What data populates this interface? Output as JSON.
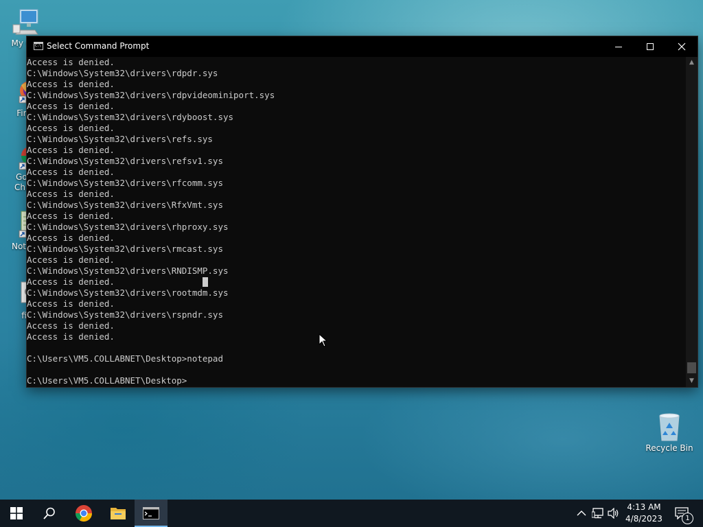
{
  "desktop": {
    "icons": [
      {
        "label": "My Co",
        "icon": "computer-icon"
      },
      {
        "label": "Fire",
        "icon": "firefox-icon"
      },
      {
        "label": "Goo",
        "label2": "Chro",
        "icon": "chrome-icon"
      },
      {
        "label": "Notep",
        "icon": "notepad-icon"
      },
      {
        "label": "fi",
        "icon": "file-icon"
      },
      {
        "label": "Recycle Bin",
        "icon": "recycle-bin-icon"
      }
    ]
  },
  "window": {
    "title": "Select Command Prompt",
    "controls": {
      "minimize": "minimize",
      "maximize": "maximize",
      "close": "close"
    }
  },
  "console": {
    "lines": [
      "Access is denied.",
      "C:\\Windows\\System32\\drivers\\rdpdr.sys",
      "Access is denied.",
      "C:\\Windows\\System32\\drivers\\rdpvideominiport.sys",
      "Access is denied.",
      "C:\\Windows\\System32\\drivers\\rdyboost.sys",
      "Access is denied.",
      "C:\\Windows\\System32\\drivers\\refs.sys",
      "Access is denied.",
      "C:\\Windows\\System32\\drivers\\refsv1.sys",
      "Access is denied.",
      "C:\\Windows\\System32\\drivers\\rfcomm.sys",
      "Access is denied.",
      "C:\\Windows\\System32\\drivers\\RfxVmt.sys",
      "Access is denied.",
      "C:\\Windows\\System32\\drivers\\rhproxy.sys",
      "Access is denied.",
      "C:\\Windows\\System32\\drivers\\rmcast.sys",
      "Access is denied.",
      "C:\\Windows\\System32\\drivers\\RNDISMP.sys",
      "Access is denied.",
      "C:\\Windows\\System32\\drivers\\rootmdm.sys",
      "Access is denied.",
      "C:\\Windows\\System32\\drivers\\rspndr.sys",
      "Access is denied.",
      "Access is denied.",
      "",
      "C:\\Users\\VM5.COLLABNET\\Desktop>notepad",
      "",
      "C:\\Users\\VM5.COLLABNET\\Desktop>"
    ]
  },
  "taskbar": {
    "apps": [
      {
        "name": "start",
        "icon": "windows-logo-icon"
      },
      {
        "name": "search",
        "icon": "search-icon"
      },
      {
        "name": "chrome",
        "icon": "chrome-icon"
      },
      {
        "name": "file-explorer",
        "icon": "folder-icon"
      },
      {
        "name": "command-prompt",
        "icon": "terminal-icon",
        "active": true
      }
    ],
    "tray_icons": [
      "chevron-up-icon",
      "network-icon",
      "volume-icon"
    ],
    "clock": {
      "time": "4:13 AM",
      "date": "4/8/2023"
    },
    "notifications": {
      "count": "1"
    }
  },
  "colors": {
    "console_bg": "#0c0c0c",
    "console_text": "#cccccc",
    "taskbar_bg": "#101820",
    "taskbar_active_indicator": "#76b9ed"
  }
}
